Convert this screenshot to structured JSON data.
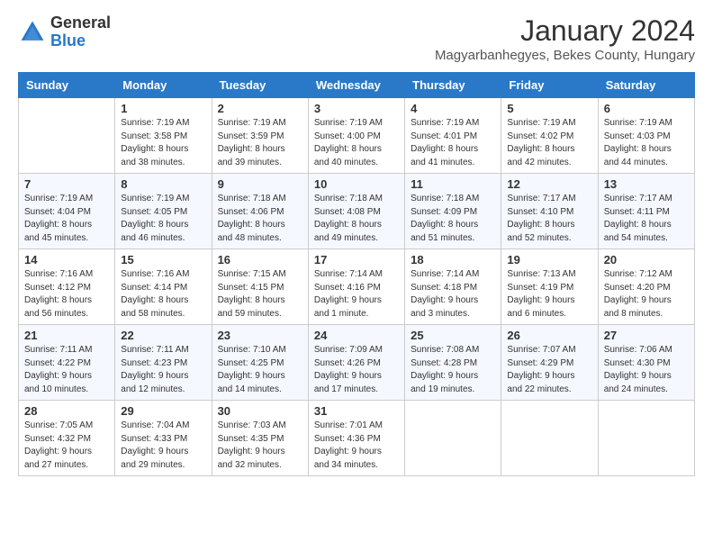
{
  "logo": {
    "general": "General",
    "blue": "Blue"
  },
  "header": {
    "month": "January 2024",
    "location": "Magyarbanhegyes, Bekes County, Hungary"
  },
  "weekdays": [
    "Sunday",
    "Monday",
    "Tuesday",
    "Wednesday",
    "Thursday",
    "Friday",
    "Saturday"
  ],
  "weeks": [
    [
      {
        "day": "",
        "info": ""
      },
      {
        "day": "1",
        "info": "Sunrise: 7:19 AM\nSunset: 3:58 PM\nDaylight: 8 hours\nand 38 minutes."
      },
      {
        "day": "2",
        "info": "Sunrise: 7:19 AM\nSunset: 3:59 PM\nDaylight: 8 hours\nand 39 minutes."
      },
      {
        "day": "3",
        "info": "Sunrise: 7:19 AM\nSunset: 4:00 PM\nDaylight: 8 hours\nand 40 minutes."
      },
      {
        "day": "4",
        "info": "Sunrise: 7:19 AM\nSunset: 4:01 PM\nDaylight: 8 hours\nand 41 minutes."
      },
      {
        "day": "5",
        "info": "Sunrise: 7:19 AM\nSunset: 4:02 PM\nDaylight: 8 hours\nand 42 minutes."
      },
      {
        "day": "6",
        "info": "Sunrise: 7:19 AM\nSunset: 4:03 PM\nDaylight: 8 hours\nand 44 minutes."
      }
    ],
    [
      {
        "day": "7",
        "info": "Sunrise: 7:19 AM\nSunset: 4:04 PM\nDaylight: 8 hours\nand 45 minutes."
      },
      {
        "day": "8",
        "info": "Sunrise: 7:19 AM\nSunset: 4:05 PM\nDaylight: 8 hours\nand 46 minutes."
      },
      {
        "day": "9",
        "info": "Sunrise: 7:18 AM\nSunset: 4:06 PM\nDaylight: 8 hours\nand 48 minutes."
      },
      {
        "day": "10",
        "info": "Sunrise: 7:18 AM\nSunset: 4:08 PM\nDaylight: 8 hours\nand 49 minutes."
      },
      {
        "day": "11",
        "info": "Sunrise: 7:18 AM\nSunset: 4:09 PM\nDaylight: 8 hours\nand 51 minutes."
      },
      {
        "day": "12",
        "info": "Sunrise: 7:17 AM\nSunset: 4:10 PM\nDaylight: 8 hours\nand 52 minutes."
      },
      {
        "day": "13",
        "info": "Sunrise: 7:17 AM\nSunset: 4:11 PM\nDaylight: 8 hours\nand 54 minutes."
      }
    ],
    [
      {
        "day": "14",
        "info": "Sunrise: 7:16 AM\nSunset: 4:12 PM\nDaylight: 8 hours\nand 56 minutes."
      },
      {
        "day": "15",
        "info": "Sunrise: 7:16 AM\nSunset: 4:14 PM\nDaylight: 8 hours\nand 58 minutes."
      },
      {
        "day": "16",
        "info": "Sunrise: 7:15 AM\nSunset: 4:15 PM\nDaylight: 8 hours\nand 59 minutes."
      },
      {
        "day": "17",
        "info": "Sunrise: 7:14 AM\nSunset: 4:16 PM\nDaylight: 9 hours\nand 1 minute."
      },
      {
        "day": "18",
        "info": "Sunrise: 7:14 AM\nSunset: 4:18 PM\nDaylight: 9 hours\nand 3 minutes."
      },
      {
        "day": "19",
        "info": "Sunrise: 7:13 AM\nSunset: 4:19 PM\nDaylight: 9 hours\nand 6 minutes."
      },
      {
        "day": "20",
        "info": "Sunrise: 7:12 AM\nSunset: 4:20 PM\nDaylight: 9 hours\nand 8 minutes."
      }
    ],
    [
      {
        "day": "21",
        "info": "Sunrise: 7:11 AM\nSunset: 4:22 PM\nDaylight: 9 hours\nand 10 minutes."
      },
      {
        "day": "22",
        "info": "Sunrise: 7:11 AM\nSunset: 4:23 PM\nDaylight: 9 hours\nand 12 minutes."
      },
      {
        "day": "23",
        "info": "Sunrise: 7:10 AM\nSunset: 4:25 PM\nDaylight: 9 hours\nand 14 minutes."
      },
      {
        "day": "24",
        "info": "Sunrise: 7:09 AM\nSunset: 4:26 PM\nDaylight: 9 hours\nand 17 minutes."
      },
      {
        "day": "25",
        "info": "Sunrise: 7:08 AM\nSunset: 4:28 PM\nDaylight: 9 hours\nand 19 minutes."
      },
      {
        "day": "26",
        "info": "Sunrise: 7:07 AM\nSunset: 4:29 PM\nDaylight: 9 hours\nand 22 minutes."
      },
      {
        "day": "27",
        "info": "Sunrise: 7:06 AM\nSunset: 4:30 PM\nDaylight: 9 hours\nand 24 minutes."
      }
    ],
    [
      {
        "day": "28",
        "info": "Sunrise: 7:05 AM\nSunset: 4:32 PM\nDaylight: 9 hours\nand 27 minutes."
      },
      {
        "day": "29",
        "info": "Sunrise: 7:04 AM\nSunset: 4:33 PM\nDaylight: 9 hours\nand 29 minutes."
      },
      {
        "day": "30",
        "info": "Sunrise: 7:03 AM\nSunset: 4:35 PM\nDaylight: 9 hours\nand 32 minutes."
      },
      {
        "day": "31",
        "info": "Sunrise: 7:01 AM\nSunset: 4:36 PM\nDaylight: 9 hours\nand 34 minutes."
      },
      {
        "day": "",
        "info": ""
      },
      {
        "day": "",
        "info": ""
      },
      {
        "day": "",
        "info": ""
      }
    ]
  ]
}
